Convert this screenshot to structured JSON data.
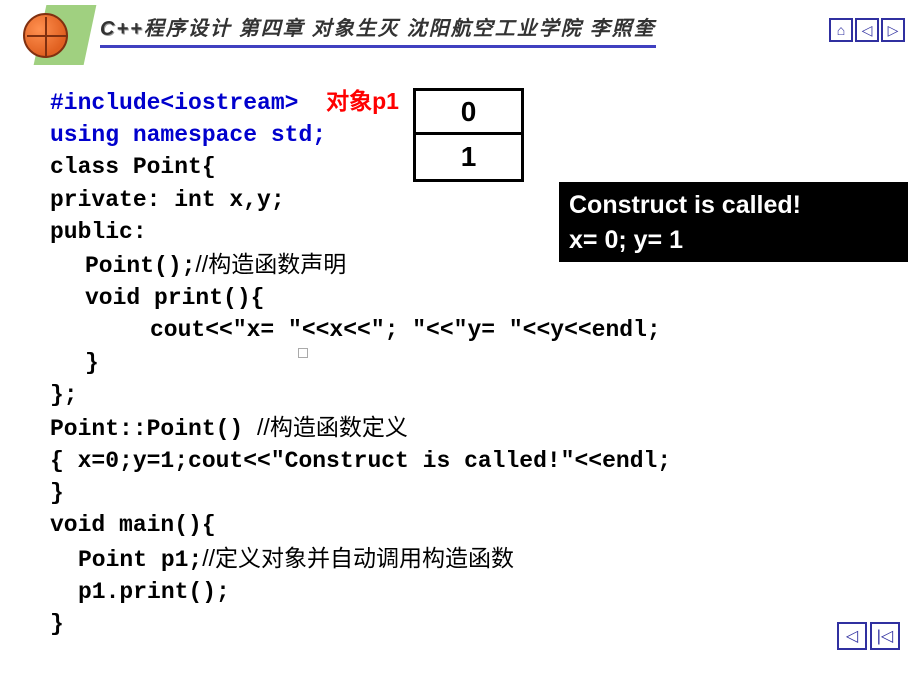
{
  "header": {
    "cpp": "C++",
    "title_rest": "程序设计 第四章 对象生灭  沈阳航空工业学院 李照奎"
  },
  "label_p1": "对象p1",
  "values": {
    "x": "0",
    "y": "1"
  },
  "output": {
    "line1": "Construct is called!",
    "line2": "x= 0;   y= 1"
  },
  "code": {
    "l1": "#include<iostream>",
    "l2": "using namespace std;",
    "l3": "class Point{",
    "l4": "private:  int x,y;",
    "l5": "public:",
    "l6a": "Point();",
    "l6b": "//构造函数声明",
    "l7": "void print(){",
    "l8": "cout<<\"x= \"<<x<<\";   \"<<\"y= \"<<y<<endl;",
    "l9": "}",
    "l10": "};",
    "l11a": "Point::Point()  ",
    "l11b": "//构造函数定义",
    "l12": "{  x=0;y=1;cout<<\"Construct is called!\"<<endl;",
    "l13": "}",
    "l14": "void main(){",
    "l15a": "Point p1;",
    "l15b": "//定义对象并自动调用构造函数",
    "l16": "p1.print();",
    "l17": "}"
  }
}
